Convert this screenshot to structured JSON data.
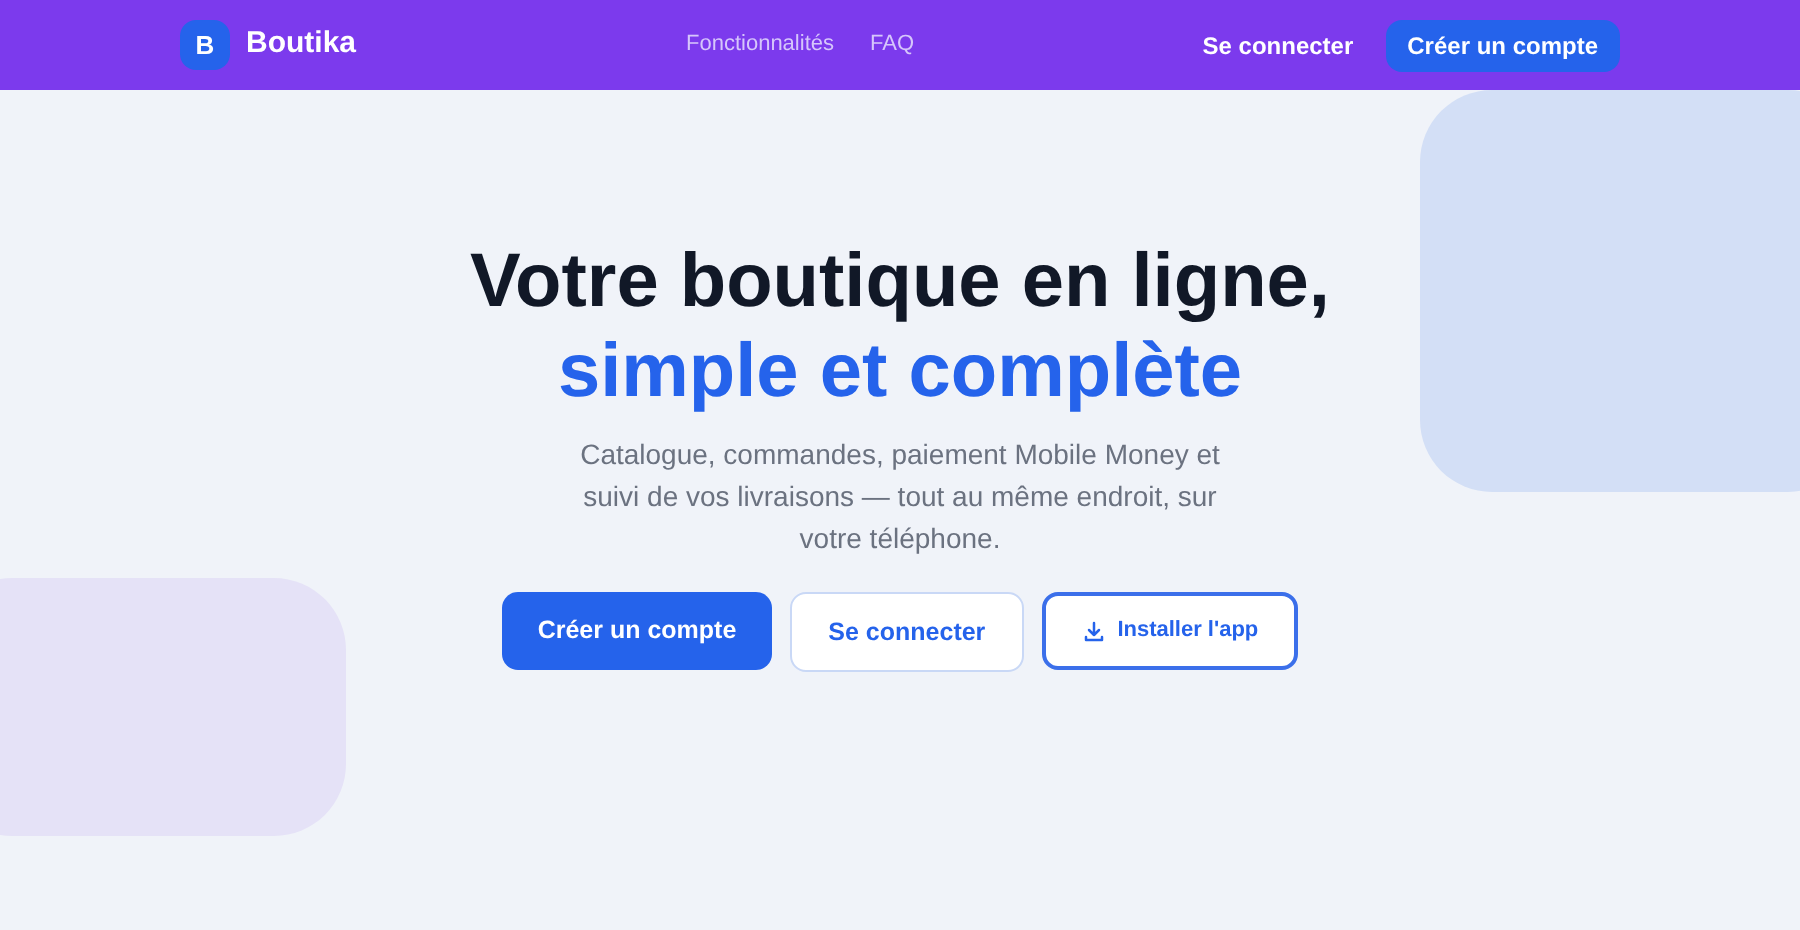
{
  "nav": {
    "logo_letter": "B",
    "brand": "Boutika",
    "links": [
      "Fonctionnalités",
      "FAQ"
    ],
    "login": "Se connecter",
    "signup": "Créer un compte"
  },
  "hero": {
    "title_line1": "Votre boutique en ligne,",
    "title_line2": "simple et complète",
    "subtitle": "Catalogue, commandes, paiement Mobile Money et suivi de vos livraisons — tout au même endroit, sur votre téléphone.",
    "buttons": [
      {
        "label": "Créer un compte",
        "kind": "primary"
      },
      {
        "label": "Se connecter",
        "kind": "secondary"
      },
      {
        "label": "Installer l'app",
        "kind": "install"
      }
    ]
  }
}
